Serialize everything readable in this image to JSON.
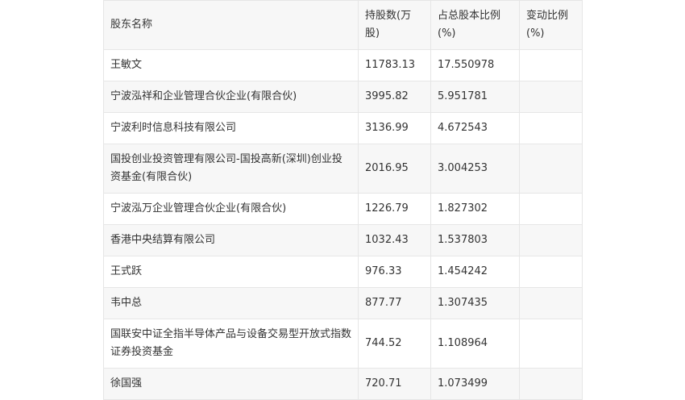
{
  "table": {
    "headers": [
      "股东名称",
      "持股数(万股)",
      "占总股本比例(%)",
      "变动比例(%)"
    ],
    "rows": [
      {
        "name": "王敏文",
        "shares": "11783.13",
        "ratio": "17.550978",
        "change": ""
      },
      {
        "name": "宁波泓祥和企业管理合伙企业(有限合伙)",
        "shares": "3995.82",
        "ratio": "5.951781",
        "change": ""
      },
      {
        "name": "宁波利时信息科技有限公司",
        "shares": "3136.99",
        "ratio": "4.672543",
        "change": ""
      },
      {
        "name": "国投创业投资管理有限公司-国投高新(深圳)创业投资基金(有限合伙)",
        "shares": "2016.95",
        "ratio": "3.004253",
        "change": ""
      },
      {
        "name": "宁波泓万企业管理合伙企业(有限合伙)",
        "shares": "1226.79",
        "ratio": "1.827302",
        "change": ""
      },
      {
        "name": "香港中央结算有限公司",
        "shares": "1032.43",
        "ratio": "1.537803",
        "change": ""
      },
      {
        "name": "王式跃",
        "shares": "976.33",
        "ratio": "1.454242",
        "change": ""
      },
      {
        "name": "韦中总",
        "shares": "877.77",
        "ratio": "1.307435",
        "change": ""
      },
      {
        "name": "国联安中证全指半导体产品与设备交易型开放式指数证券投资基金",
        "shares": "744.52",
        "ratio": "1.108964",
        "change": ""
      },
      {
        "name": "徐国强",
        "shares": "720.71",
        "ratio": "1.073499",
        "change": ""
      }
    ]
  }
}
